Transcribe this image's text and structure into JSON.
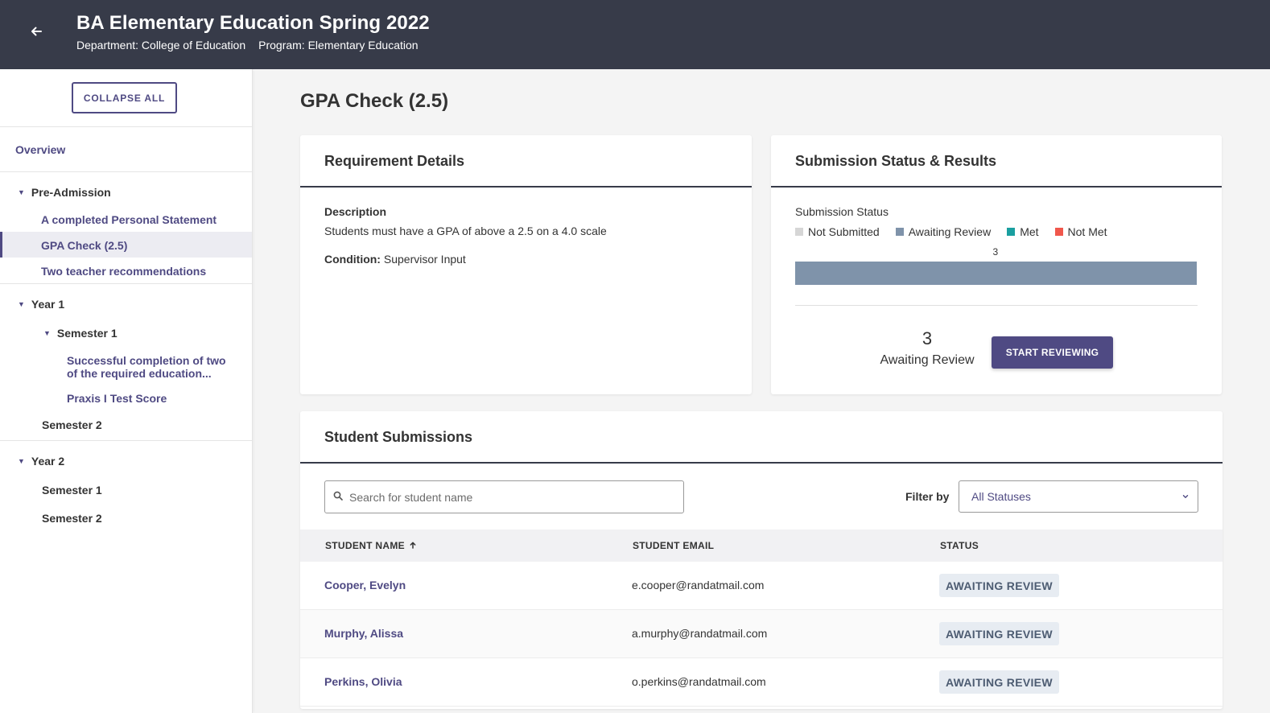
{
  "header": {
    "title": "BA Elementary Education Spring 2022",
    "department": "Department: College of Education",
    "program": "Program: Elementary Education",
    "back_icon": "arrow-left-icon"
  },
  "sidebar": {
    "collapse_label": "COLLAPSE ALL",
    "overview": "Overview",
    "pre_admission": {
      "label": "Pre-Admission",
      "items": [
        "A completed Personal Statement",
        "GPA Check (2.5)",
        "Two teacher recommendations"
      ]
    },
    "year1": {
      "label": "Year 1",
      "semester1": {
        "label": "Semester 1",
        "items": [
          "Successful completion of two of the required education...",
          "Praxis I Test Score"
        ]
      },
      "semester2": "Semester 2"
    },
    "year2": {
      "label": "Year 2",
      "semester1": "Semester 1",
      "semester2": "Semester 2"
    },
    "selected": "GPA Check (2.5)"
  },
  "main": {
    "page_title": "GPA Check (2.5)",
    "requirement": {
      "title": "Requirement Details",
      "description_label": "Description",
      "description": "Students must have a GPA of above a 2.5 on a 4.0 scale",
      "condition_label": "Condition:",
      "condition_value": "Supervisor Input"
    },
    "submission": {
      "title": "Submission Status & Results",
      "status_label": "Submission Status",
      "legend": [
        {
          "label": "Not Submitted",
          "color": "#d6d6d6"
        },
        {
          "label": "Awaiting Review",
          "color": "#7f93aa"
        },
        {
          "label": "Met",
          "color": "#1a9fa0"
        },
        {
          "label": "Not Met",
          "color": "#f0574c"
        }
      ],
      "count": "3",
      "count_label": "Awaiting Review",
      "start_label": "START REVIEWING"
    },
    "students": {
      "title": "Student Submissions",
      "search_placeholder": "Search for student name",
      "filter_label": "Filter by",
      "filter_value": "All Statuses",
      "columns": [
        "STUDENT NAME",
        "STUDENT EMAIL",
        "STATUS"
      ],
      "rows": [
        {
          "name": "Cooper, Evelyn",
          "email": "e.cooper@randatmail.com",
          "status": "AWAITING REVIEW"
        },
        {
          "name": "Murphy, Alissa",
          "email": "a.murphy@randatmail.com",
          "status": "AWAITING REVIEW"
        },
        {
          "name": "Perkins, Olivia",
          "email": "o.perkins@randatmail.com",
          "status": "AWAITING REVIEW"
        }
      ]
    }
  },
  "chart_data": {
    "type": "bar",
    "orientation": "horizontal-stacked",
    "categories": [
      "Not Submitted",
      "Awaiting Review",
      "Met",
      "Not Met"
    ],
    "values": [
      0,
      3,
      0,
      0
    ],
    "data_labels": [
      "3"
    ]
  },
  "colors": {
    "header_bg": "#373b49",
    "accent": "#4f4a83",
    "badge_bg": "#e7ecf2",
    "badge_text": "#4d5c72"
  }
}
